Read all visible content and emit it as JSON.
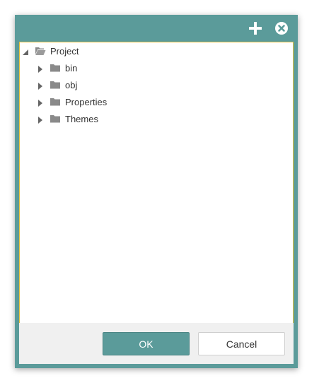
{
  "titlebar": {
    "icons": [
      "plus-icon",
      "close-circle-icon"
    ]
  },
  "tree": {
    "root": {
      "label": "Project",
      "expanded": true,
      "icon": "folder-open-icon"
    },
    "children": [
      {
        "label": "bin",
        "expanded": false,
        "icon": "folder-icon"
      },
      {
        "label": "obj",
        "expanded": false,
        "icon": "folder-icon"
      },
      {
        "label": "Properties",
        "expanded": false,
        "icon": "folder-icon"
      },
      {
        "label": "Themes",
        "expanded": false,
        "icon": "folder-icon"
      }
    ]
  },
  "footer": {
    "ok_label": "OK",
    "cancel_label": "Cancel"
  },
  "colors": {
    "accent": "#5b9b9a",
    "tree_border": "#e3c03b",
    "footer_bg": "#f0f0f0"
  }
}
